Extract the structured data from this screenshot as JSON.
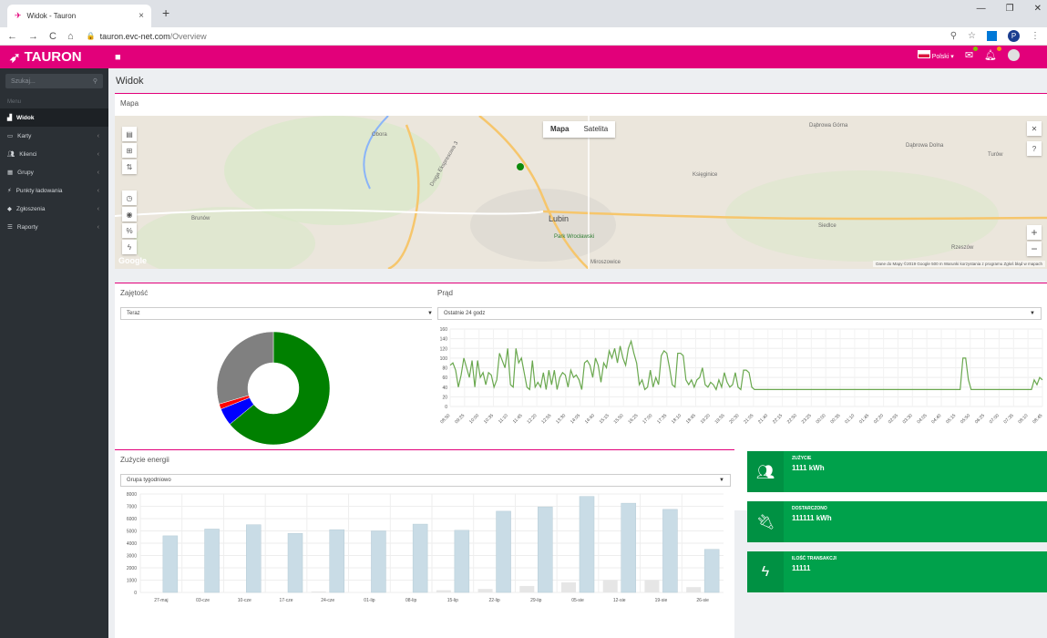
{
  "browser": {
    "tab_title": "Widok - Tauron",
    "url_host": "tauron.evc-net.com",
    "url_path": "/Overview",
    "profile_initial": "P"
  },
  "header": {
    "logo": "TAURON",
    "language": "Polski",
    "brand_color": "#e2007a"
  },
  "sidebar": {
    "search_placeholder": "Szukaj...",
    "menu_header": "Menu",
    "items": [
      {
        "label": "Widok",
        "icon": "bar-chart-icon",
        "active": true
      },
      {
        "label": "Karty",
        "icon": "card-icon"
      },
      {
        "label": "Klienci",
        "icon": "users-icon"
      },
      {
        "label": "Grupy",
        "icon": "group-icon"
      },
      {
        "label": "Punkty ładowania",
        "icon": "plug-icon"
      },
      {
        "label": "Zgłoszenia",
        "icon": "tag-icon"
      },
      {
        "label": "Raporty",
        "icon": "list-icon"
      }
    ]
  },
  "page": {
    "title": "Widok"
  },
  "map": {
    "title": "Mapa",
    "type_map": "Mapa",
    "type_satellite": "Satelita",
    "labels": [
      "Obora",
      "Droga Ekspresowa 3",
      "Księginice",
      "Dąbrowa Górna",
      "Dąbrowa Dolna",
      "Turów",
      "Lubin",
      "Park Wrocławski",
      "Brunów",
      "Siedlce",
      "Miroszowice",
      "Rzeszów"
    ],
    "google": "Google",
    "footer": "Dane do Mapy ©2019 Google   500 m   Warunki korzystania z programu   Zgłoś błąd w mapach"
  },
  "occupancy": {
    "title": "Zajętość",
    "select": "Teraz",
    "chart_data": {
      "type": "pie",
      "labels": [
        "",
        "",
        "",
        ""
      ],
      "values": [
        64,
        5,
        1.5,
        29.5
      ],
      "colors": [
        "#008000",
        "#0000ff",
        "#ff0000",
        "#808080"
      ]
    }
  },
  "current": {
    "title": "Prąd",
    "select": "Ostatnie 24 godz",
    "chart_data": {
      "type": "line",
      "ylim": [
        0,
        160
      ],
      "yticks": [
        0,
        20,
        40,
        60,
        80,
        100,
        120,
        140,
        160
      ],
      "xticks": [
        "08:50",
        "09:25",
        "10:00",
        "10:35",
        "11:10",
        "11:45",
        "12:20",
        "12:55",
        "13:30",
        "14:05",
        "14:40",
        "15:15",
        "15:50",
        "16:25",
        "17:00",
        "17:35",
        "18:10",
        "18:45",
        "19:20",
        "19:55",
        "20:30",
        "21:05",
        "21:40",
        "22:15",
        "22:50",
        "23:25",
        "00:00",
        "00:35",
        "01:10",
        "01:45",
        "02:20",
        "02:55",
        "03:30",
        "04:05",
        "04:40",
        "05:15",
        "05:50",
        "06:25",
        "07:00",
        "07:35",
        "08:10",
        "08:45"
      ],
      "series": [
        {
          "color": "#6aa84f",
          "values": [
            85,
            90,
            75,
            40,
            65,
            100,
            80,
            60,
            95,
            40,
            95,
            60,
            70,
            45,
            70,
            65,
            40,
            55,
            110,
            95,
            80,
            120,
            45,
            40,
            120,
            90,
            100,
            70,
            40,
            35,
            95,
            40,
            50,
            40,
            70,
            35,
            75,
            45,
            75,
            35,
            60,
            70,
            65,
            40,
            75,
            60,
            65,
            55,
            35,
            90,
            95,
            85,
            60,
            100,
            85,
            50,
            90,
            80,
            115,
            100,
            120,
            90,
            125,
            100,
            85,
            120,
            135,
            110,
            90,
            45,
            55,
            35,
            40,
            75,
            40,
            60,
            45,
            105,
            115,
            110,
            80,
            45,
            40,
            110,
            110,
            105,
            55,
            45,
            55,
            40,
            55,
            60,
            80,
            45,
            40,
            50,
            45,
            35,
            55,
            40,
            70,
            50,
            40,
            45,
            70,
            40,
            35,
            75,
            75,
            70,
            40,
            35,
            35,
            35,
            35,
            35,
            35,
            35,
            35,
            35,
            35,
            35,
            35,
            35,
            35,
            35,
            35,
            35,
            35,
            35,
            35,
            35,
            35,
            35,
            35,
            35,
            35,
            35,
            35,
            35,
            35,
            35,
            35,
            35,
            35,
            35,
            35,
            35,
            35,
            35,
            35,
            35,
            35,
            35,
            35,
            35,
            35,
            35,
            35,
            35,
            35,
            35,
            35,
            35,
            35,
            35,
            35,
            35,
            35,
            35,
            35,
            35,
            35,
            35,
            35,
            35,
            35,
            35,
            35,
            35,
            35,
            35,
            35,
            35,
            35,
            35,
            35,
            100,
            100,
            55,
            35,
            35,
            35,
            35,
            35,
            35,
            35,
            35,
            35,
            35,
            35,
            35,
            35,
            35,
            35,
            35,
            35,
            35,
            35,
            35,
            35,
            35,
            35,
            55,
            45,
            60,
            55
          ]
        }
      ]
    }
  },
  "energy": {
    "title": "Zużycie energii",
    "select": "Grupa tygodniowo",
    "chart_data": {
      "type": "bar",
      "ylim": [
        0,
        8000
      ],
      "yticks": [
        0,
        1000,
        2000,
        3000,
        4000,
        5000,
        6000,
        7000,
        8000
      ],
      "categories": [
        "27-maj",
        "03-cze",
        "10-cze",
        "17-cze",
        "24-cze",
        "01-lip",
        "08-lip",
        "15-lip",
        "22-lip",
        "29-lip",
        "05-sie",
        "12-sie",
        "19-sie",
        "26-sie"
      ],
      "series": [
        {
          "color": "#e6e6e6",
          "values": [
            0,
            0,
            0,
            0,
            80,
            0,
            0,
            180,
            280,
            520,
            820,
            1000,
            1000,
            430
          ]
        },
        {
          "color": "#c9dce6",
          "values": [
            4600,
            5150,
            5500,
            4800,
            5100,
            5000,
            5550,
            5050,
            6600,
            6950,
            7800,
            7250,
            6750,
            3500
          ]
        }
      ]
    }
  },
  "stats": [
    {
      "label": "ZUŻYCIE",
      "value": "1111 kWh",
      "icon": "users-icon"
    },
    {
      "label": "DOSTARCZONO",
      "value": "111111 kWh",
      "icon": "plug-icon"
    },
    {
      "label": "ILOŚĆ TRANSAKCJI",
      "value": "11111",
      "icon": "bolt-icon"
    }
  ]
}
